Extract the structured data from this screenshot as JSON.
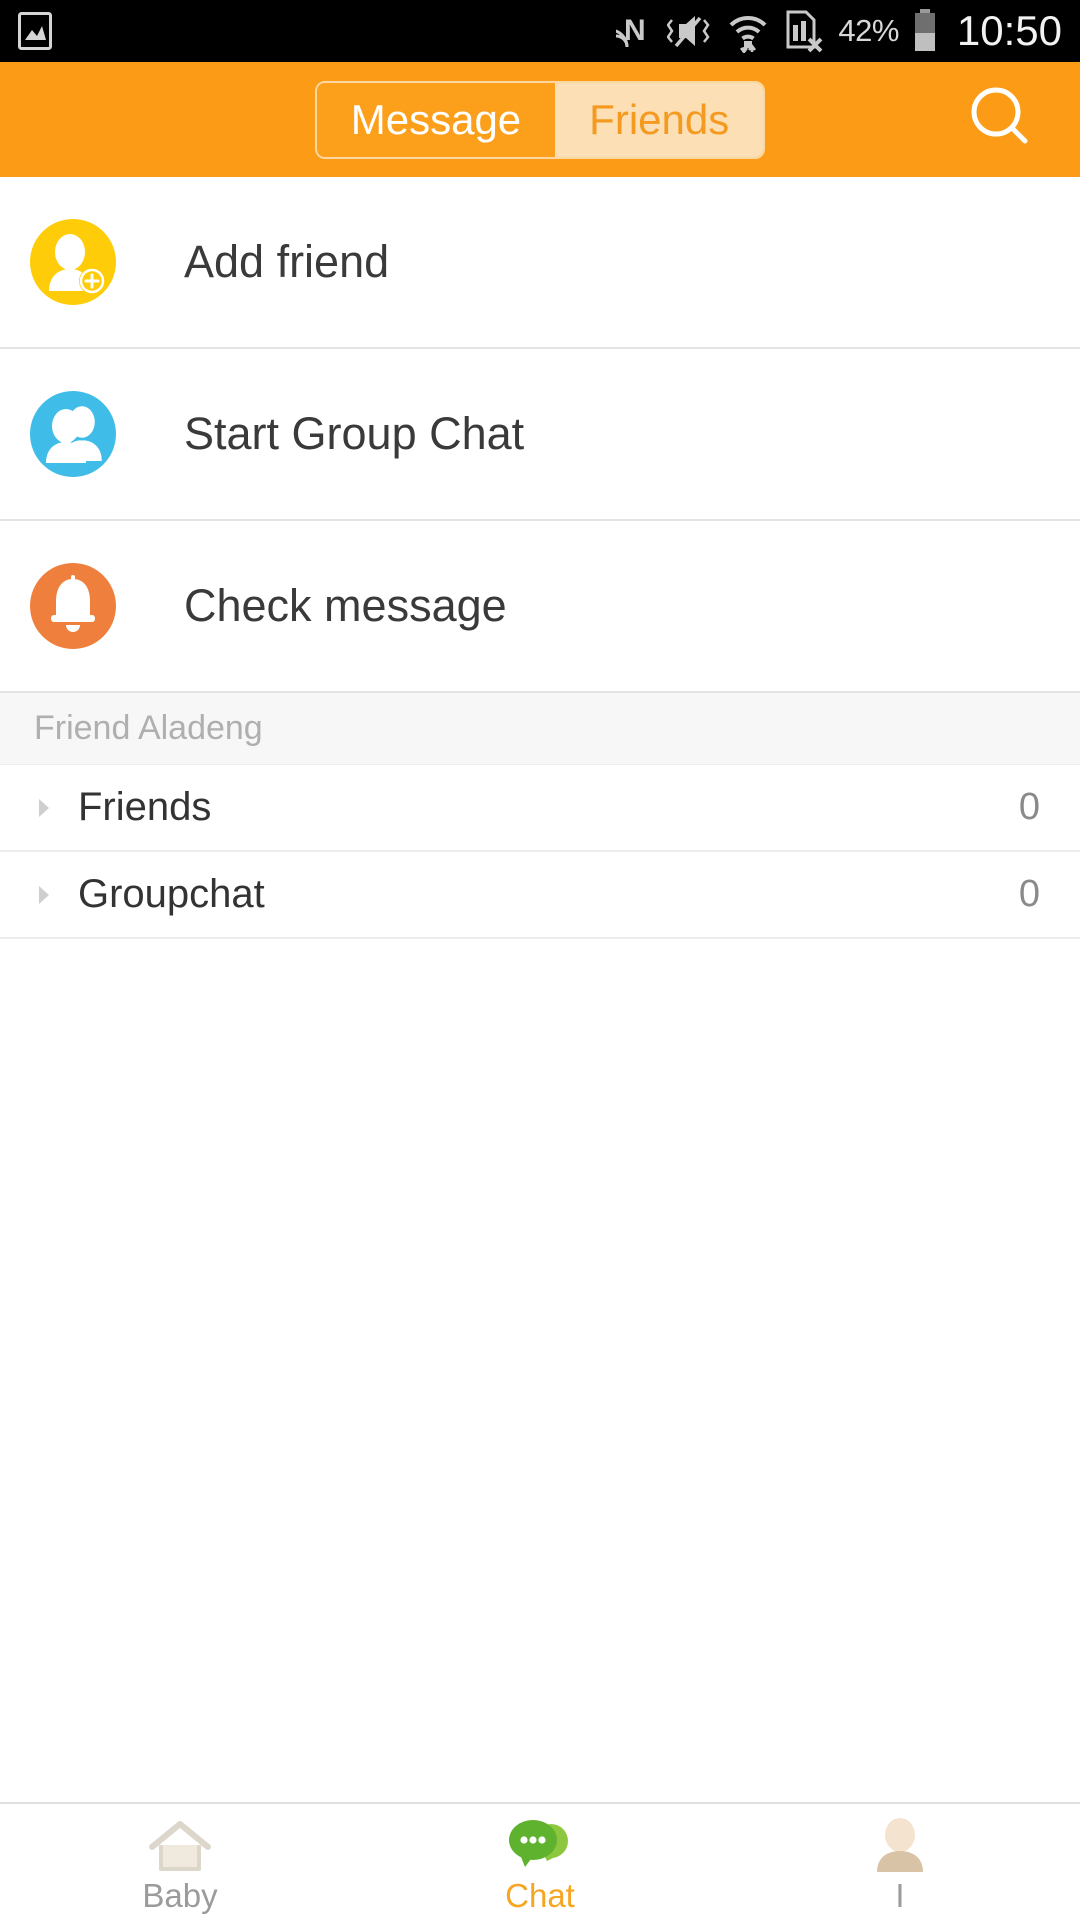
{
  "status_bar": {
    "left_icons": [
      "image-gallery-icon"
    ],
    "right_icons": [
      "nfc-icon",
      "mute-vibrate-icon",
      "wifi-transfer-icon",
      "sim-card-error-icon"
    ],
    "battery_percent": "42%",
    "clock": "10:50"
  },
  "header": {
    "tabs": [
      {
        "label": "Message",
        "active": true
      },
      {
        "label": "Friends",
        "active": false
      }
    ],
    "search_icon": "search-icon",
    "bg_color": "#FB9B16",
    "active_tab_bg": "#FCA01B",
    "inactive_tab_bg": "#FCDFB4",
    "inactive_tab_text": "#F59A20"
  },
  "actions": [
    {
      "label": "Add friend",
      "icon": "add-friend-icon",
      "color": "#FFCC0A"
    },
    {
      "label": "Start Group Chat",
      "icon": "group-chat-icon",
      "color": "#3FBCE8"
    },
    {
      "label": "Check message",
      "icon": "bell-icon",
      "color": "#EE7F3C"
    }
  ],
  "section": {
    "title": "Friend Aladeng"
  },
  "groups": [
    {
      "label": "Friends",
      "count": "0",
      "caret": "caret-right-icon"
    },
    {
      "label": "Groupchat",
      "count": "0",
      "caret": "caret-right-icon"
    }
  ],
  "bottom_nav": [
    {
      "label": "Baby",
      "icon": "home-icon",
      "active": false
    },
    {
      "label": "Chat",
      "icon": "chat-bubble-icon",
      "active": true
    },
    {
      "label": "I",
      "icon": "profile-icon",
      "active": false
    }
  ],
  "colors": {
    "accent": "#F5A623",
    "nav_active_text": "#F5A623",
    "nav_inactive_text": "#9b9b9b"
  }
}
